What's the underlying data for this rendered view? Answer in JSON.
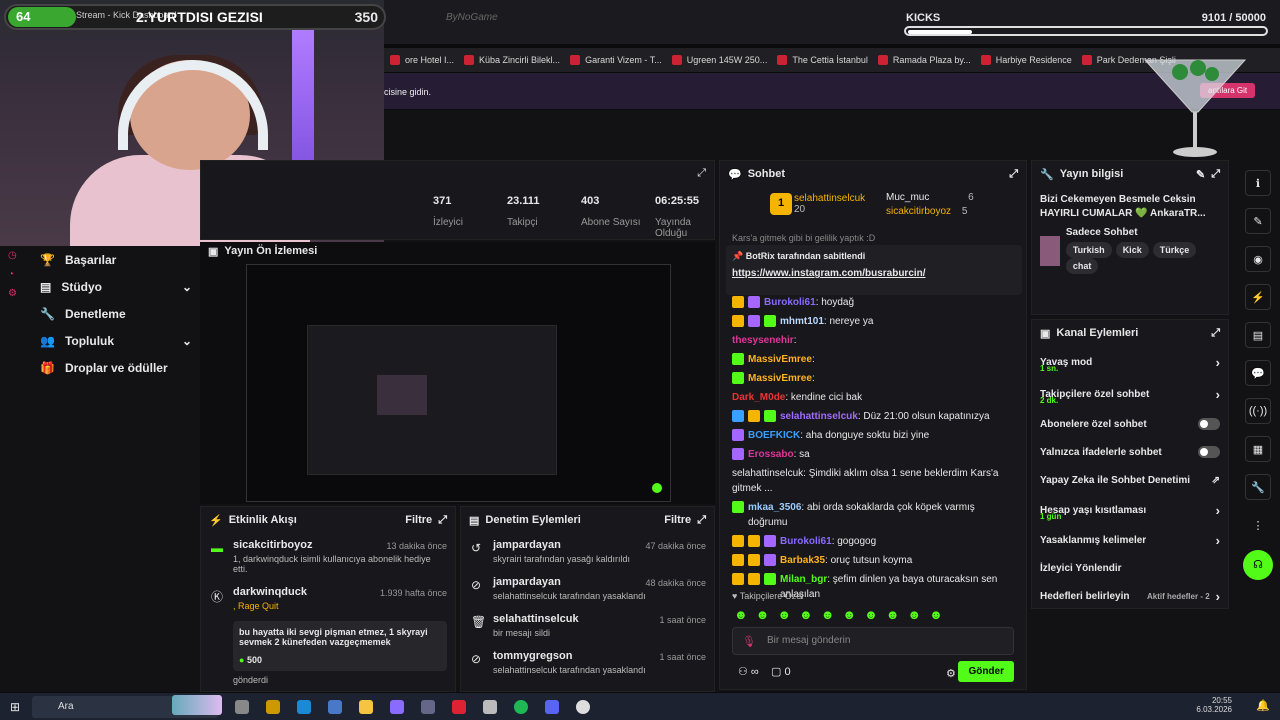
{
  "overlay": {
    "level": "64",
    "mini": "Stream - Kick Dashboard",
    "title": "2.YURTDISI GEZISI",
    "count": "350"
  },
  "center_logo": "ByNoGame",
  "kicks": {
    "label": "KICKS",
    "value": "9101 / 50000",
    "progress": 0.182
  },
  "bookmarks": [
    "ore Hotel I...",
    "Küba Zincirli Bilekl...",
    "Garanti Vizem - T...",
    "Ugreen 145W 250...",
    "The Cettia İstanbul",
    "Ramada Plaza by...",
    "Harbiye Residence",
    "Park Dedeman Şişli"
  ],
  "banner": {
    "text": "icisine gidin.",
    "button": "antılara Git"
  },
  "stats": {
    "items": [
      {
        "v": "371",
        "l": "İzleyici"
      },
      {
        "v": "23.111",
        "l": "Takipçi"
      },
      {
        "v": "403",
        "l": "Abone Sayısı"
      },
      {
        "v": "06:25:55",
        "l": "Yayında Olduğu"
      }
    ]
  },
  "preview": {
    "title": "Yayın Ön İzlemesi"
  },
  "nav": [
    {
      "label": "Başarılar",
      "icon": "trophy-icon"
    },
    {
      "label": "Stüdyo",
      "icon": "studio-icon",
      "chev": true
    },
    {
      "label": "Denetleme",
      "icon": "wrench-icon"
    },
    {
      "label": "Topluluk",
      "icon": "community-icon",
      "chev": true
    },
    {
      "label": "Droplar ve ödüller",
      "icon": "gift-icon"
    }
  ],
  "activity": {
    "title": "Etkinlik Akışı",
    "filter": "Filtre",
    "rows": [
      {
        "name": "sicakcitirboyoz",
        "time": "13 dakika önce",
        "sub": "1, darkwinqduck isimli kullanıcıya abonelik hediye etti."
      },
      {
        "name": "darkwinqduck",
        "time": "1.939 hafta önce",
        "sub": ", Rage Quit"
      }
    ],
    "gift_text": "bu hayatta iki sevgi pişman etmez, 1 skyrayi sevmek 2 künefeden vazgeçmemek",
    "gift_amount": "500",
    "gift_sent": "gönderdi"
  },
  "moderation": {
    "title": "Denetim Eylemleri",
    "filter": "Filtre",
    "rows": [
      {
        "name": "jampardayan",
        "time": "47 dakika önce",
        "sub": "skyrairi tarafından yasağı kaldırıldı"
      },
      {
        "name": "jampardayan",
        "time": "48 dakika önce",
        "sub": "selahattinselcuk tarafından yasaklandı"
      },
      {
        "name": "selahattinselcuk",
        "time": "1 saat önce",
        "sub": "bir mesajı sildi"
      },
      {
        "name": "tommygregson",
        "time": "1 saat önce",
        "sub": "selahattinselcuk tarafından yasaklandı"
      }
    ]
  },
  "chat": {
    "title": "Sohbet",
    "leader1": {
      "name": "selahattinselcuk",
      "n": "20"
    },
    "leader2": {
      "name": "Muc_muc",
      "n": "6"
    },
    "leader3": {
      "name": "sicakcitirboyoz",
      "n": "5"
    },
    "scroll_text": "Kars'a gitmek gibi bi gelilik yaptık :D",
    "pinned_by": "BotRix tarafından sabitlendi",
    "pinned_link": "https://www.instagram.com/busraburcin/",
    "messages": [
      {
        "u": "Burokoli61",
        "c": "#8a6bff",
        "t": "hoydağ",
        "b": [
          "b-y",
          "b-p"
        ]
      },
      {
        "u": "mhmt101",
        "c": "#bcd9ff",
        "t": "nereye ya",
        "b": [
          "b-y",
          "b-p",
          "b-g"
        ]
      },
      {
        "u": "thesysenehir",
        "c": "#e0359a",
        "t": "",
        "b": []
      },
      {
        "u": "MassivEmree",
        "c": "#ffb21f",
        "t": "",
        "b": [
          "b-g"
        ]
      },
      {
        "u": "MassivEmree",
        "c": "#ffb21f",
        "t": "",
        "b": [
          "b-g"
        ]
      },
      {
        "u": "Dark_M0de",
        "c": "#e33",
        "t": "kendine cici bak",
        "b": []
      },
      {
        "u": "selahattinselcuk",
        "c": "#a06bff",
        "t": "Düz 21:00 olsun kapatınızya",
        "b": [
          "b-b",
          "b-y",
          "b-g"
        ]
      },
      {
        "u": "BOEFKICK",
        "c": "#3aa0ff",
        "t": "aha donguye soktu bizi yine",
        "b": [
          "b-p"
        ]
      },
      {
        "u": "Erossabo",
        "c": "#e0359a",
        "t": "sa",
        "b": [
          "b-p"
        ]
      },
      {
        "u": "",
        "c": "#999",
        "t": "selahattinselcuk: Şimdiki aklım olsa 1 sene beklerdim Kars'a gitmek ...",
        "b": []
      },
      {
        "u": "mkaa_3506",
        "c": "#9cf",
        "t": "abi orda sokaklarda çok köpek varmış doğrumu",
        "b": [
          "b-g"
        ]
      },
      {
        "u": "Burokoli61",
        "c": "#8a6bff",
        "t": "gogogog",
        "b": [
          "b-y",
          "b-y",
          "b-p"
        ]
      },
      {
        "u": "Barbak35",
        "c": "#ffb21f",
        "t": "oruç tutsun koyma",
        "b": [
          "b-y",
          "b-y",
          "b-p"
        ]
      },
      {
        "u": "Milan_bgr",
        "c": "#53fc18",
        "t": "şefim dinlen ya baya oturacaksın sen anlaşılan",
        "b": [
          "b-y",
          "b-y",
          "b-g"
        ]
      }
    ],
    "followers_label": "Takipçilere Özel",
    "placeholder": "Bir mesaj gönderin",
    "count": "0",
    "send": "Gönder"
  },
  "info": {
    "title": "Yayın bilgisi",
    "stream_title": "Bizi Cekemeyen Besmele Ceksin HAYIRLI CUMALAR 💚 AnkaraTR...",
    "category": "Sadece Sohbet",
    "tags": [
      "Turkish",
      "Kick",
      "Türkçe",
      "chat"
    ]
  },
  "actions": {
    "title": "Kanal Eylemleri",
    "items": [
      {
        "l": "Yavaş mod",
        "s": "1 sn.",
        "k": "arrow"
      },
      {
        "l": "Takipçilere özel sohbet",
        "s": "2 dk.",
        "k": "arrow"
      },
      {
        "l": "Abonelere özel sohbet",
        "k": "toggle"
      },
      {
        "l": "Yalnızca ifadelerle sohbet",
        "k": "toggle"
      },
      {
        "l": "Yapay Zeka ile Sohbet Denetimi",
        "k": "ext"
      },
      {
        "l": "Hesap yaşı kısıtlaması",
        "s": "1 gün",
        "k": "arrow"
      },
      {
        "l": "Yasaklanmış kelimeler",
        "k": "arrow"
      },
      {
        "l": "İzleyici Yönlendir",
        "k": ""
      },
      {
        "l": "Hedefleri belirleyin",
        "s2": "Aktif hedefler - 2",
        "k": "arrow"
      }
    ]
  },
  "taskbar": {
    "search": "Ara",
    "time": "20:55",
    "date": "6.03.2026"
  },
  "colors": {
    "accent": "#53fc18"
  }
}
